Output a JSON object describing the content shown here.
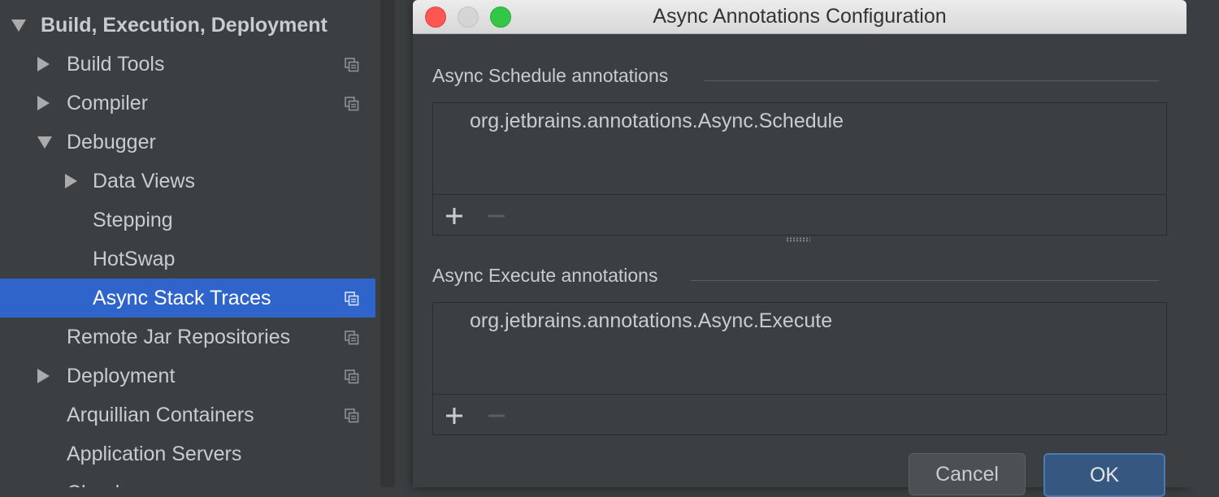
{
  "sidebar": {
    "items": [
      {
        "label": "Build, Execution, Deployment",
        "arrow": "down",
        "indent": 0,
        "bold": true,
        "copy_icon": false,
        "selected": false
      },
      {
        "label": "Build Tools",
        "arrow": "right",
        "indent": 1,
        "bold": false,
        "copy_icon": true,
        "selected": false
      },
      {
        "label": "Compiler",
        "arrow": "right",
        "indent": 1,
        "bold": false,
        "copy_icon": true,
        "selected": false
      },
      {
        "label": "Debugger",
        "arrow": "down",
        "indent": 1,
        "bold": false,
        "copy_icon": false,
        "selected": false
      },
      {
        "label": "Data Views",
        "arrow": "right",
        "indent": 2,
        "bold": false,
        "copy_icon": false,
        "selected": false
      },
      {
        "label": "Stepping",
        "arrow": "none",
        "indent": 2,
        "bold": false,
        "copy_icon": false,
        "selected": false
      },
      {
        "label": "HotSwap",
        "arrow": "none",
        "indent": 2,
        "bold": false,
        "copy_icon": false,
        "selected": false
      },
      {
        "label": "Async Stack Traces",
        "arrow": "none",
        "indent": 2,
        "bold": false,
        "copy_icon": true,
        "selected": true
      },
      {
        "label": "Remote Jar Repositories",
        "arrow": "none",
        "indent": 1,
        "bold": false,
        "copy_icon": true,
        "selected": false
      },
      {
        "label": "Deployment",
        "arrow": "right",
        "indent": 1,
        "bold": false,
        "copy_icon": true,
        "selected": false
      },
      {
        "label": "Arquillian Containers",
        "arrow": "none",
        "indent": 1,
        "bold": false,
        "copy_icon": true,
        "selected": false
      },
      {
        "label": "Application Servers",
        "arrow": "none",
        "indent": 1,
        "bold": false,
        "copy_icon": false,
        "selected": false
      },
      {
        "label": "Clouds",
        "arrow": "none",
        "indent": 1,
        "bold": false,
        "copy_icon": false,
        "selected": false
      }
    ],
    "selected_color": "#2f65ca"
  },
  "dialog": {
    "title": "Async Annotations Configuration",
    "schedule": {
      "title": "Async Schedule annotations",
      "items": [
        "org.jetbrains.annotations.Async.Schedule"
      ]
    },
    "execute": {
      "title": "Async Execute annotations",
      "items": [
        "org.jetbrains.annotations.Async.Execute"
      ]
    },
    "cancel_label": "Cancel",
    "ok_label": "OK"
  }
}
